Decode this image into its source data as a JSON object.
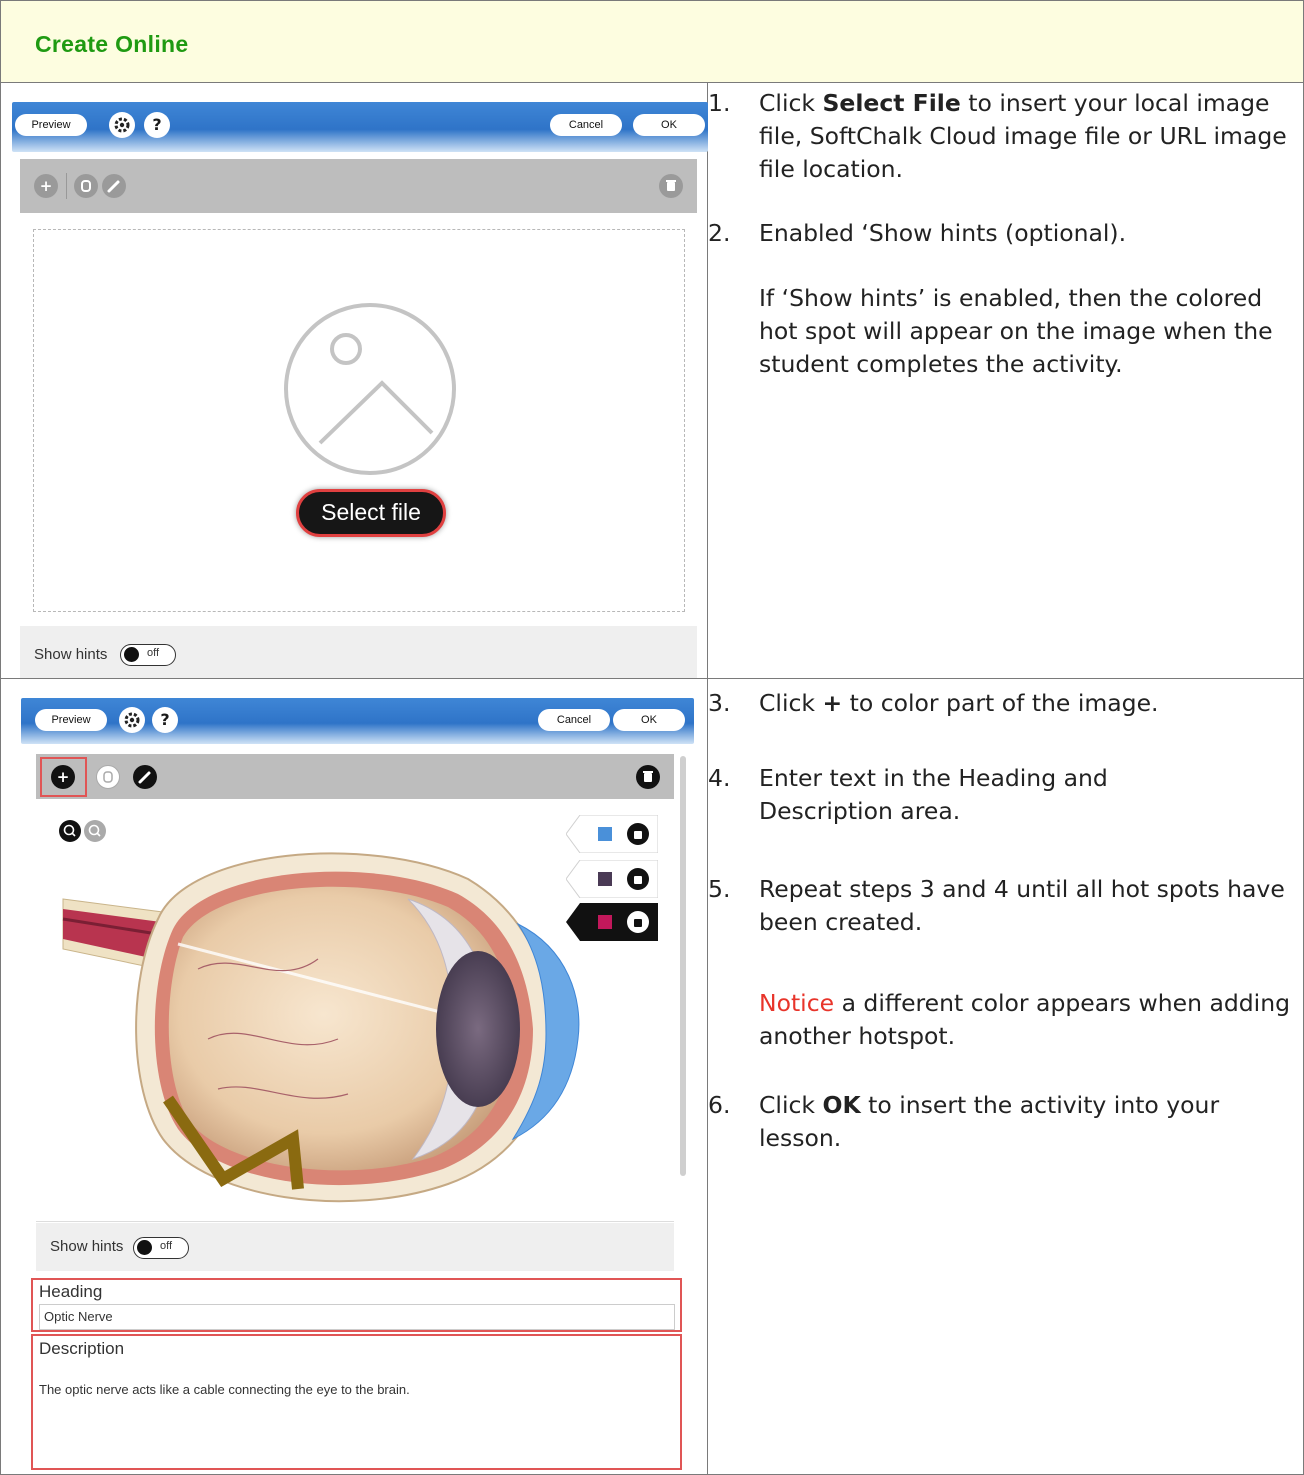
{
  "header": {
    "title": "Create Online"
  },
  "editor": {
    "preview_label": "Preview",
    "settings_icon": "gear-icon",
    "help_label": "?",
    "cancel_label": "Cancel",
    "ok_label": "OK",
    "select_file_label": "Select file",
    "show_hints_label": "Show hints",
    "toggle_state": "off",
    "plus_label": "+",
    "heading_label": "Heading",
    "heading_value": "Optic Nerve",
    "description_label": "Description",
    "description_value": "The optic nerve acts like a cable connecting the eye to the brain.",
    "hotspot_colors": [
      "#4a90d9",
      "#4a3a55",
      "#c2185b"
    ]
  },
  "steps_top": [
    {
      "num": "1.",
      "pre": "Click ",
      "bold": "Select File",
      "post": " to insert your local image file, SoftChalk Cloud image file or URL image file location."
    },
    {
      "num": "2.",
      "text": "Enabled ‘Show hints (optional)."
    },
    {
      "note": "If ‘Show hints’ is enabled, then the colored hot spot will appear on the image when the student completes the activity."
    }
  ],
  "steps_bottom": [
    {
      "num": "3.",
      "pre": "Click ",
      "bold": "+",
      "post": " to color part of the image."
    },
    {
      "num": "4.",
      "text": "Enter text in the Heading and Description area."
    },
    {
      "num": "5.",
      "text": "Repeat steps 3 and 4 until all hot spots have been created."
    },
    {
      "notice": "Notice",
      "rest": " a different color appears when adding another hotspot."
    },
    {
      "num": "6.",
      "pre": "Click ",
      "bold": "OK",
      "post": " to insert the activity into your lesson."
    }
  ]
}
